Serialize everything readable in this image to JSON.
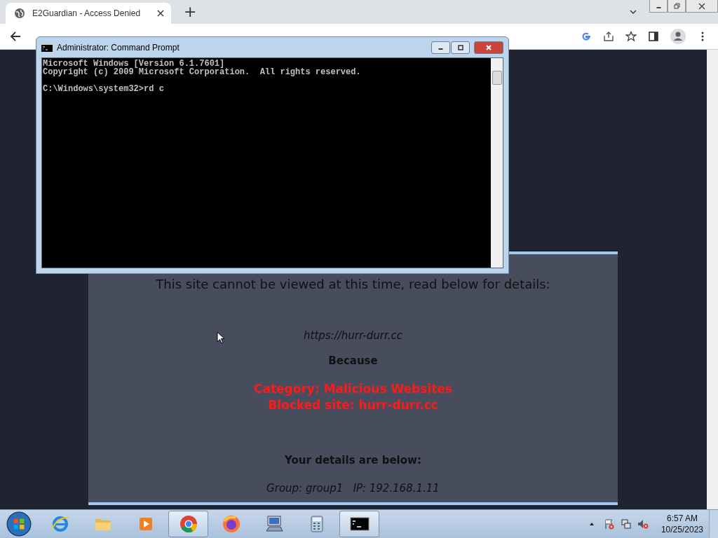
{
  "browser": {
    "tab_title": "E2Guardian - Access Denied",
    "new_tab": "+"
  },
  "console_window": {
    "title": "Administrator: Command Prompt",
    "blocks": [
      [
        "Microsoft Windows [Version 6.1.7601]",
        "Copyright (c) 2009 Microsoft Corporation.  All rights reserved."
      ],
      [
        "C:\\Windows\\system32>rd c"
      ]
    ]
  },
  "page": {
    "heading": "This site cannot be viewed at this time, read below for details:",
    "url": "https://hurr-durr.cc",
    "because": "Because",
    "reasons": [
      "Category: Malicious Websites",
      "Blocked site: hurr-durr.cc"
    ],
    "details_heading": "Your details are below:",
    "details": "Group: group1   IP: 192.168.1.11"
  },
  "taskbar": {
    "apps": [
      {
        "kind": "ie",
        "selected": false
      },
      {
        "kind": "folder",
        "selected": false
      },
      {
        "kind": "media",
        "selected": false
      },
      {
        "kind": "chrome",
        "selected": true
      },
      {
        "kind": "firefox",
        "selected": false
      },
      {
        "kind": "computer",
        "selected": false
      },
      {
        "kind": "calculator",
        "selected": false
      },
      {
        "kind": "console",
        "selected": true
      }
    ],
    "time": "6:57 AM",
    "date": "10/25/2023"
  }
}
